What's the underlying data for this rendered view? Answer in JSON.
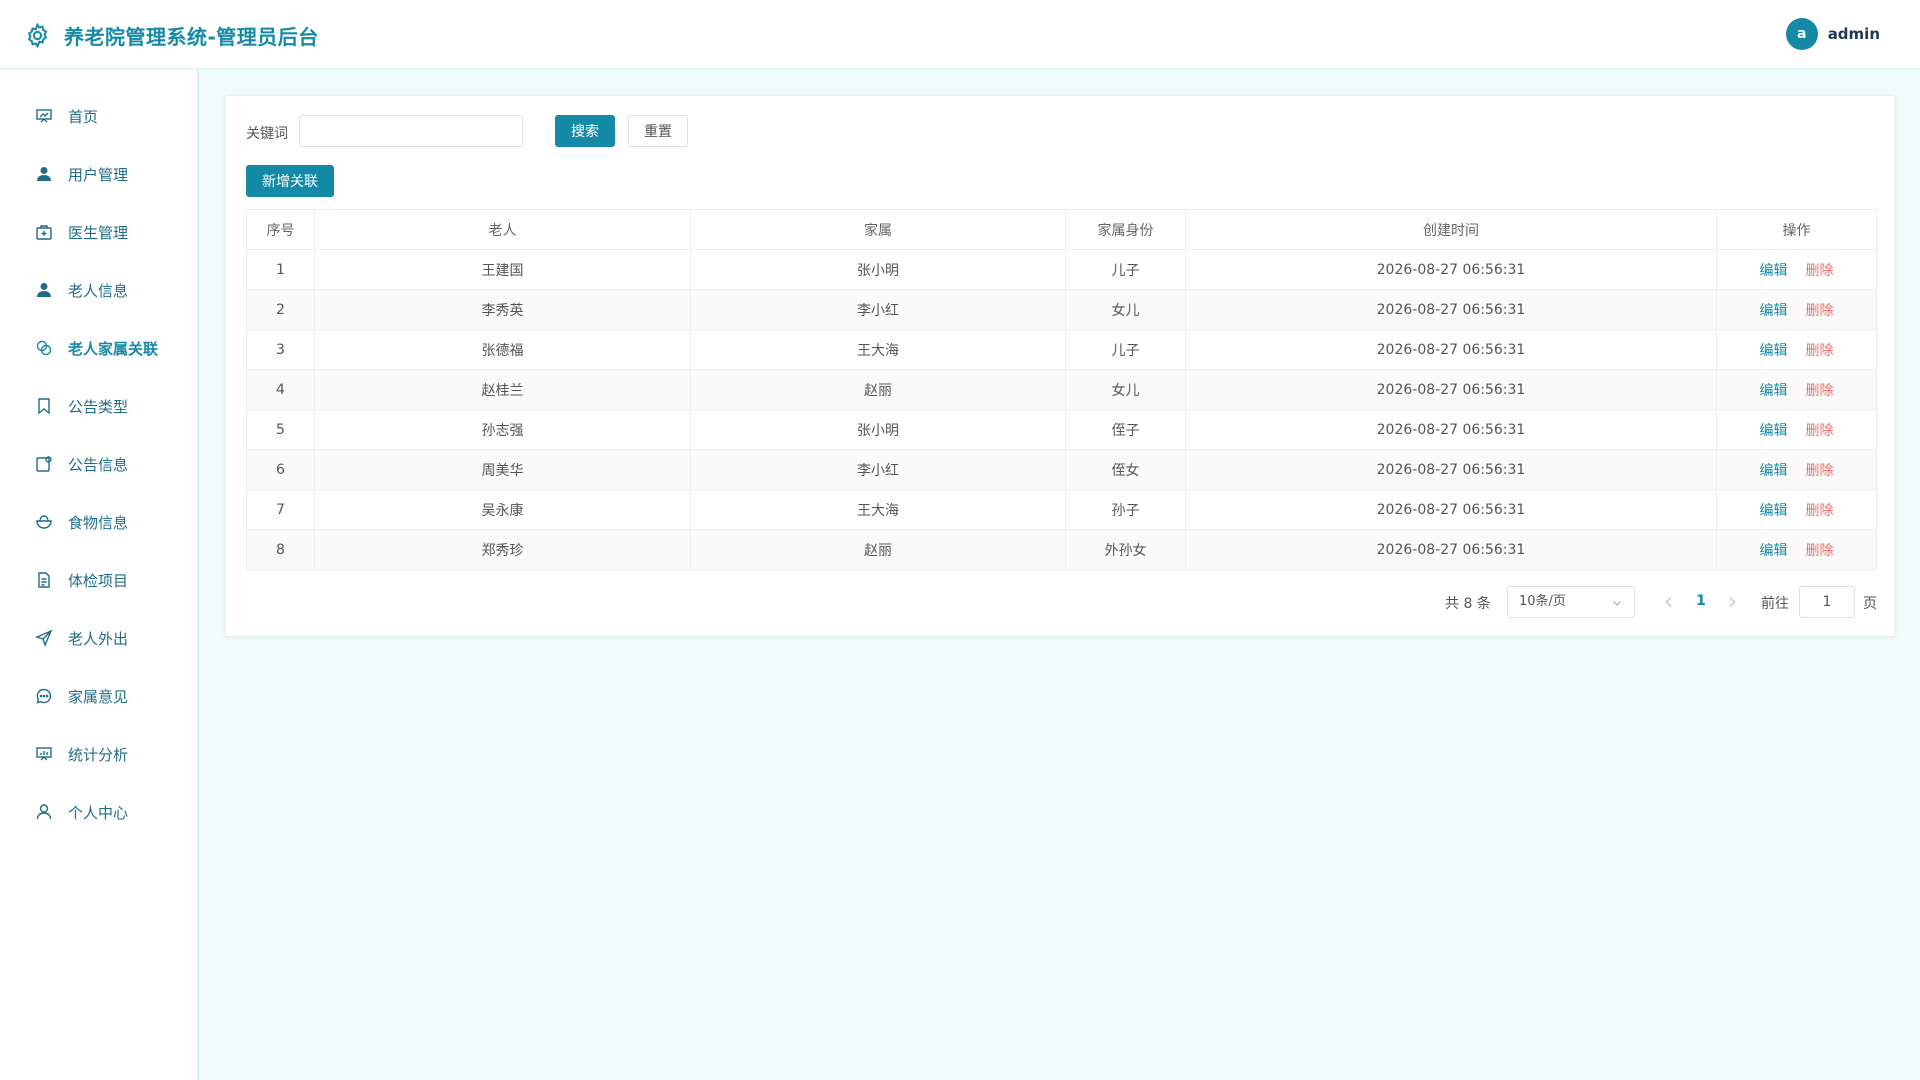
{
  "header": {
    "title": "养老院管理系统-管理员后台",
    "logo_icon": "gear-icon",
    "avatar_letter": "a",
    "username": "admin"
  },
  "sidebar": {
    "items": [
      {
        "label": "首页",
        "icon": "dashboard-icon",
        "active": false
      },
      {
        "label": "用户管理",
        "icon": "user-icon",
        "active": false
      },
      {
        "label": "医生管理",
        "icon": "medical-kit-icon",
        "active": false
      },
      {
        "label": "老人信息",
        "icon": "user-icon",
        "active": false
      },
      {
        "label": "老人家属关联",
        "icon": "link-icon",
        "active": true
      },
      {
        "label": "公告类型",
        "icon": "bookmark-icon",
        "active": false
      },
      {
        "label": "公告信息",
        "icon": "notice-icon",
        "active": false
      },
      {
        "label": "食物信息",
        "icon": "food-icon",
        "active": false
      },
      {
        "label": "体检项目",
        "icon": "document-icon",
        "active": false
      },
      {
        "label": "老人外出",
        "icon": "send-icon",
        "active": false
      },
      {
        "label": "家属意见",
        "icon": "chat-icon",
        "active": false
      },
      {
        "label": "统计分析",
        "icon": "chart-icon",
        "active": false
      },
      {
        "label": "个人中心",
        "icon": "person-icon",
        "active": false
      }
    ]
  },
  "search": {
    "label": "关键词",
    "value": "",
    "placeholder": "",
    "search_button": "搜索",
    "reset_button": "重置"
  },
  "toolbar": {
    "add_button": "新增关联"
  },
  "table": {
    "columns": [
      "序号",
      "老人",
      "家属",
      "家属身份",
      "创建时间",
      "操作"
    ],
    "rows": [
      {
        "index": "1",
        "elder": "王建国",
        "family": "张小明",
        "relation": "儿子",
        "created": "2026-08-27 06:56:31"
      },
      {
        "index": "2",
        "elder": "李秀英",
        "family": "李小红",
        "relation": "女儿",
        "created": "2026-08-27 06:56:31"
      },
      {
        "index": "3",
        "elder": "张德福",
        "family": "王大海",
        "relation": "儿子",
        "created": "2026-08-27 06:56:31"
      },
      {
        "index": "4",
        "elder": "赵桂兰",
        "family": "赵丽",
        "relation": "女儿",
        "created": "2026-08-27 06:56:31"
      },
      {
        "index": "5",
        "elder": "孙志强",
        "family": "张小明",
        "relation": "侄子",
        "created": "2026-08-27 06:56:31"
      },
      {
        "index": "6",
        "elder": "周美华",
        "family": "李小红",
        "relation": "侄女",
        "created": "2026-08-27 06:56:31"
      },
      {
        "index": "7",
        "elder": "吴永康",
        "family": "王大海",
        "relation": "孙子",
        "created": "2026-08-27 06:56:31"
      },
      {
        "index": "8",
        "elder": "郑秀珍",
        "family": "赵丽",
        "relation": "外孙女",
        "created": "2026-08-27 06:56:31"
      }
    ],
    "edit_label": "编辑",
    "delete_label": "删除"
  },
  "pagination": {
    "total_text": "共 8 条",
    "page_size": "10条/页",
    "current_page": "1",
    "goto_label": "前往",
    "goto_value": "1",
    "page_suffix": "页"
  },
  "colors": {
    "accent": "#148aa6",
    "danger": "#f56c6c",
    "background": "#f0fbfa"
  }
}
